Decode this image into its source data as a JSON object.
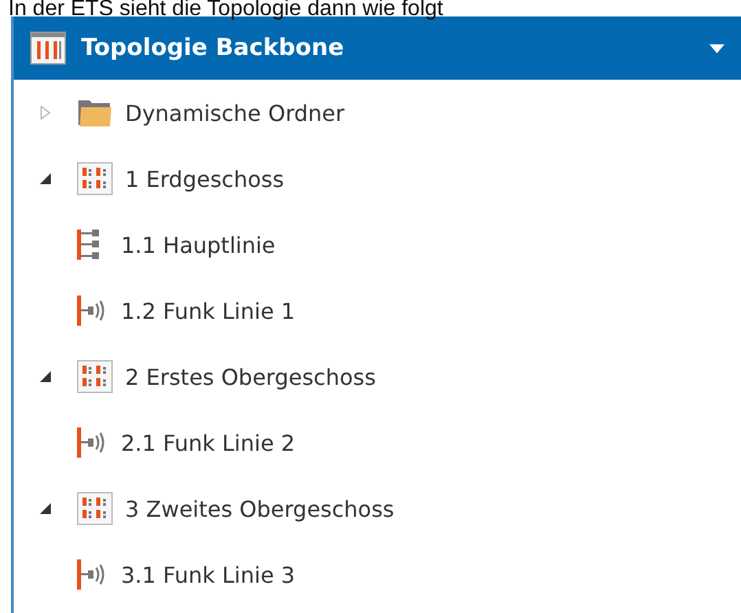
{
  "caption": "In der ETS sieht die Topologie dann wie folgt",
  "panel": {
    "title": "Topologie Backbone",
    "tree": [
      {
        "label": "Dynamische Ordner",
        "kind": "folder",
        "expanded": false
      },
      {
        "label": "1 Erdgeschoss",
        "kind": "area",
        "expanded": true,
        "children": [
          {
            "label": "1.1 Hauptlinie",
            "kind": "mainline"
          },
          {
            "label": "1.2 Funk Linie 1",
            "kind": "rfline"
          }
        ]
      },
      {
        "label": "2 Erstes Obergeschoss",
        "kind": "area",
        "expanded": true,
        "children": [
          {
            "label": "2.1 Funk Linie 2",
            "kind": "rfline"
          }
        ]
      },
      {
        "label": "3 Zweites Obergeschoss",
        "kind": "area",
        "expanded": true,
        "children": [
          {
            "label": "3.1 Funk Linie 3",
            "kind": "rfline"
          }
        ]
      }
    ]
  }
}
